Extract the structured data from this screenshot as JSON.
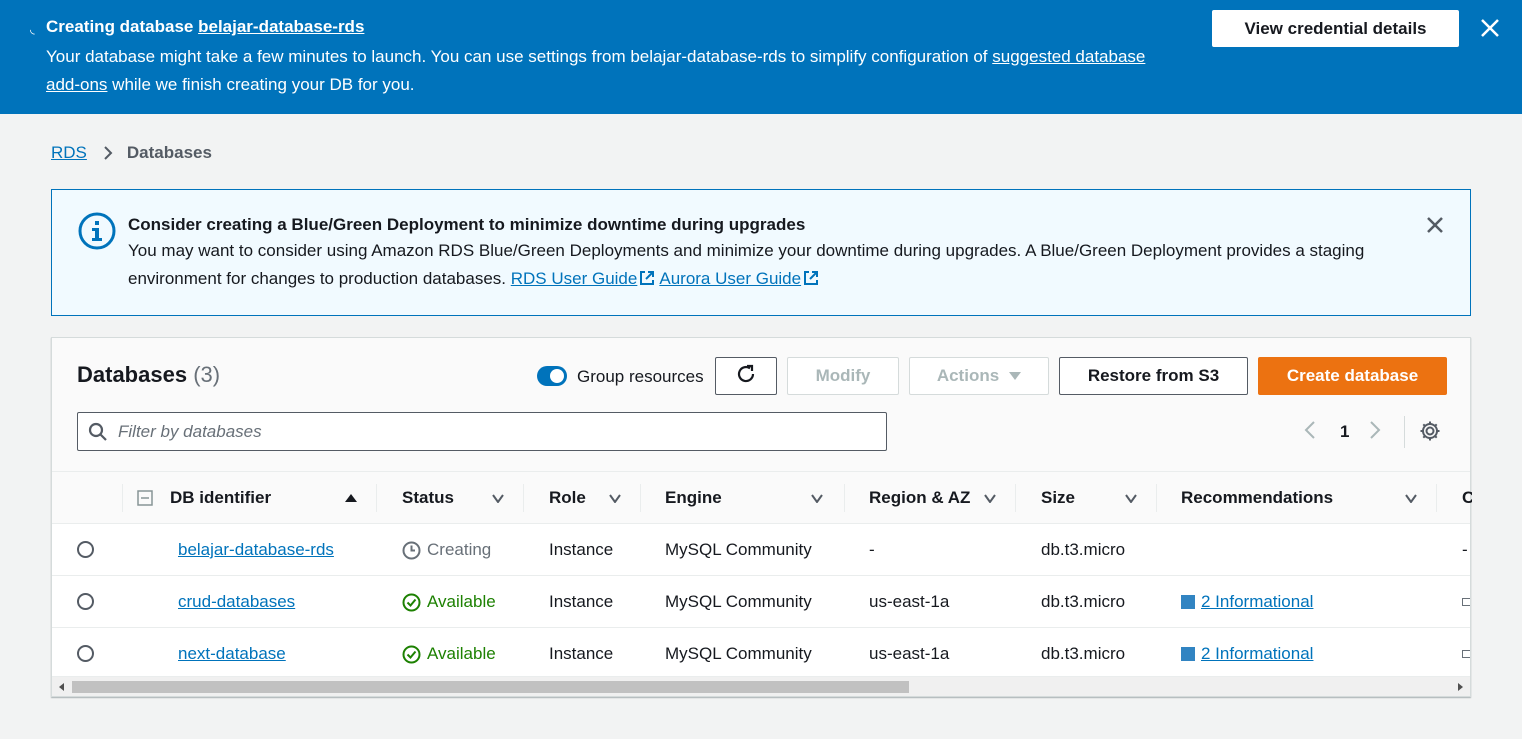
{
  "flash": {
    "title_prefix": "Creating database ",
    "title_link": "belajar-database-rds",
    "message_prefix": "Your database might take a few minutes to launch. You can use settings from belajar-database-rds to simplify configuration of ",
    "message_link": "suggested database add-ons",
    "message_suffix": " while we finish creating your DB for you.",
    "credential_button": "View credential details",
    "background_color": "#0073bb"
  },
  "breadcrumb": {
    "root": "RDS",
    "current": "Databases"
  },
  "info_alert": {
    "heading": "Consider creating a Blue/Green Deployment to minimize downtime during upgrades",
    "body": "You may want to consider using Amazon RDS Blue/Green Deployments and minimize your downtime during upgrades. A Blue/Green Deployment provides a staging environment for changes to production databases. ",
    "link1": "RDS User Guide",
    "link2": "Aurora User Guide"
  },
  "panel": {
    "title": "Databases",
    "count": "(3)",
    "group_resources_label": "Group resources",
    "group_resources_on": true,
    "modify_label": "Modify",
    "actions_label": "Actions",
    "restore_label": "Restore from S3",
    "create_label": "Create database",
    "create_color": "#ec7211",
    "filter_placeholder": "Filter by databases",
    "page_number": "1"
  },
  "columns": [
    "DB identifier",
    "Status",
    "Role",
    "Engine",
    "Region & AZ",
    "Size",
    "Recommendations",
    "C"
  ],
  "rows": [
    {
      "id": "belajar-database-rds",
      "status": "Creating",
      "role": "Instance",
      "engine": "MySQL Community",
      "region": "-",
      "size": "db.t3.micro",
      "recommendation": "",
      "last": "-"
    },
    {
      "id": "crud-databases",
      "status": "Available",
      "role": "Instance",
      "engine": "MySQL Community",
      "region": "us-east-1a",
      "size": "db.t3.micro",
      "recommendation": "2 Informational",
      "last": ""
    },
    {
      "id": "next-database",
      "status": "Available",
      "role": "Instance",
      "engine": "MySQL Community",
      "region": "us-east-1a",
      "size": "db.t3.micro",
      "recommendation": "2 Informational",
      "last": ""
    }
  ]
}
